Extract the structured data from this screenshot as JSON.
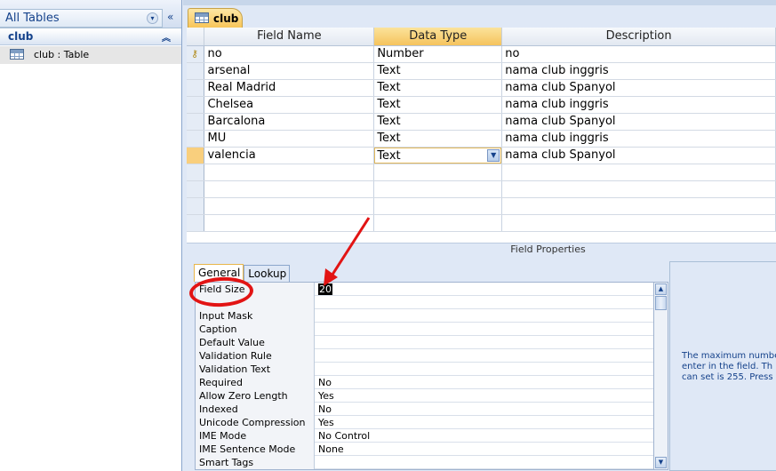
{
  "nav": {
    "title": "All Tables",
    "title_arrow": "▾",
    "collapse": "«",
    "group": "club",
    "group_chevron": "︽",
    "item": "club : Table"
  },
  "tab": {
    "label": "club"
  },
  "grid": {
    "headers": [
      "Field Name",
      "Data Type",
      "Description"
    ],
    "rows": [
      {
        "name": "no",
        "type": "Number",
        "desc": "no"
      },
      {
        "name": "arsenal",
        "type": "Text",
        "desc": "nama club inggris"
      },
      {
        "name": "Real Madrid",
        "type": "Text",
        "desc": "nama club Spanyol"
      },
      {
        "name": "Chelsea",
        "type": "Text",
        "desc": "nama club inggris"
      },
      {
        "name": "Barcalona",
        "type": "Text",
        "desc": "nama club Spanyol"
      },
      {
        "name": "MU",
        "type": "Text",
        "desc": "nama club inggris"
      },
      {
        "name": "valencia",
        "type": "Text",
        "desc": "nama club Spanyol"
      }
    ]
  },
  "field_properties": {
    "title": "Field Properties",
    "tabs": [
      "General",
      "Lookup"
    ],
    "rows": [
      {
        "name": "Field Size",
        "value": "20"
      },
      {
        "name": "",
        "value": ""
      },
      {
        "name": "Input Mask",
        "value": ""
      },
      {
        "name": "Caption",
        "value": ""
      },
      {
        "name": "Default Value",
        "value": ""
      },
      {
        "name": "Validation Rule",
        "value": ""
      },
      {
        "name": "Validation Text",
        "value": ""
      },
      {
        "name": "Required",
        "value": "No"
      },
      {
        "name": "Allow Zero Length",
        "value": "Yes"
      },
      {
        "name": "Indexed",
        "value": "No"
      },
      {
        "name": "Unicode Compression",
        "value": "Yes"
      },
      {
        "name": "IME Mode",
        "value": "No Control"
      },
      {
        "name": "IME Sentence Mode",
        "value": "None"
      },
      {
        "name": "Smart Tags",
        "value": ""
      }
    ],
    "help_lines": [
      "The maximum numbe",
      "enter in the field.  Th",
      "can set is 255.  Press"
    ]
  },
  "colors": {
    "accent_orange": "#f8c558",
    "annotation_red": "#e21414",
    "nav_text": "#15428b"
  }
}
